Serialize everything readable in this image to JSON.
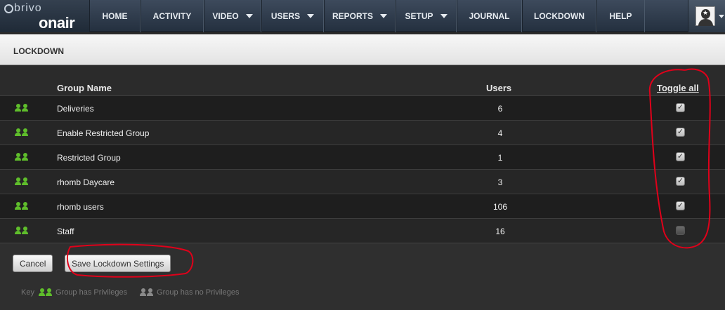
{
  "header": {
    "brand": "brivo",
    "product": "onair",
    "nav": [
      {
        "label": "HOME",
        "dropdown": false
      },
      {
        "label": "ACTIVITY",
        "dropdown": false
      },
      {
        "label": "VIDEO",
        "dropdown": true
      },
      {
        "label": "USERS",
        "dropdown": true
      },
      {
        "label": "REPORTS",
        "dropdown": true
      },
      {
        "label": "SETUP",
        "dropdown": true
      },
      {
        "label": "JOURNAL",
        "dropdown": false
      },
      {
        "label": "LOCKDOWN",
        "dropdown": false
      },
      {
        "label": "HELP",
        "dropdown": false
      }
    ]
  },
  "page": {
    "title": "LOCKDOWN"
  },
  "table": {
    "columns": {
      "group_name": "Group Name",
      "users": "Users",
      "toggle": "Toggle all"
    },
    "rows": [
      {
        "name": "Deliveries",
        "users": "6",
        "checked": true
      },
      {
        "name": "Enable Restricted Group",
        "users": "4",
        "checked": true
      },
      {
        "name": "Restricted Group",
        "users": "1",
        "checked": true
      },
      {
        "name": "rhomb Daycare",
        "users": "3",
        "checked": true
      },
      {
        "name": "rhomb users",
        "users": "106",
        "checked": true
      },
      {
        "name": "Staff",
        "users": "16",
        "checked": false
      }
    ]
  },
  "actions": {
    "cancel": "Cancel",
    "save": "Save Lockdown Settings"
  },
  "key": {
    "label": "Key",
    "has_privileges": "Group has Privileges",
    "no_privileges": "Group has no Privileges"
  },
  "colors": {
    "privilege_green": "#5fbe2b",
    "no_privilege_gray": "#8a8a8a",
    "annotation_red": "#e0001a"
  }
}
